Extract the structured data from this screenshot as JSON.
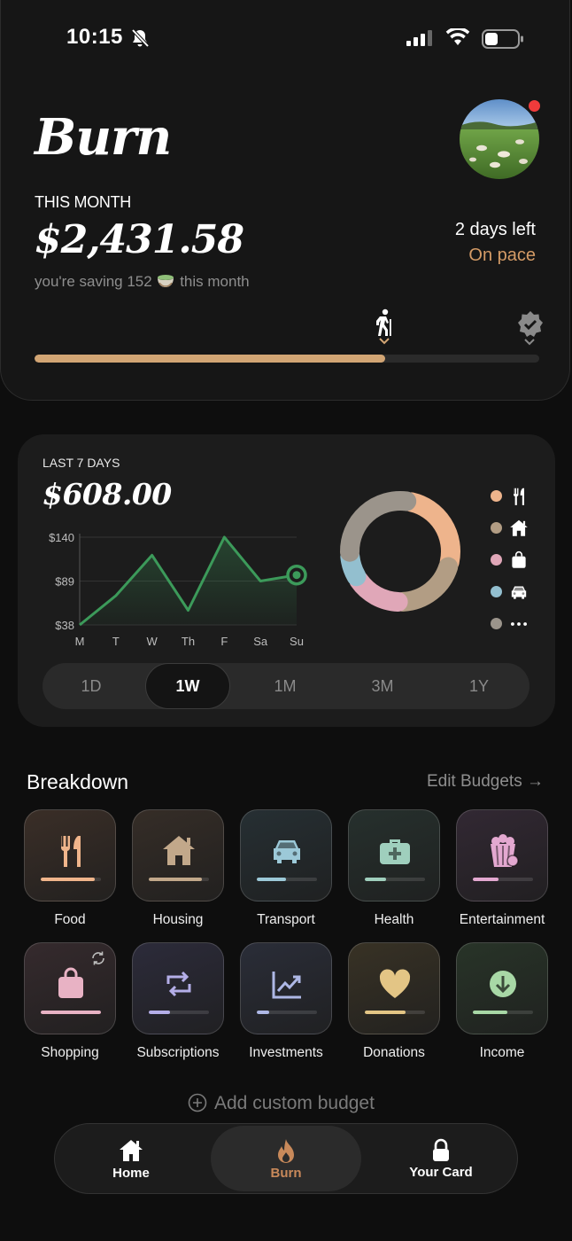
{
  "status_bar": {
    "time": "10:15"
  },
  "header": {
    "title": "Burn",
    "period_label": "THIS MONTH",
    "amount": "$2,431.58",
    "saving_text": "you're saving 152",
    "saving_suffix": "this month",
    "days_left": "2 days left",
    "pace_status": "On pace",
    "progress_fraction": 0.695,
    "accent_color": "#d2a574"
  },
  "weekly": {
    "label": "LAST 7 DAYS",
    "amount": "$608.00",
    "ranges": [
      "1D",
      "1W",
      "1M",
      "3M",
      "1Y"
    ],
    "selected_range": "1W",
    "legend": [
      {
        "icon": "fork-knife-icon",
        "color": "#eeb48c"
      },
      {
        "icon": "house-icon",
        "color": "#b29d84"
      },
      {
        "icon": "bag-icon",
        "color": "#e0a7b8"
      },
      {
        "icon": "car-icon",
        "color": "#93bfcf"
      },
      {
        "icon": "more-icon",
        "color": "#9b948b"
      }
    ]
  },
  "chart_data": [
    {
      "type": "area",
      "categories": [
        "M",
        "T",
        "W",
        "Th",
        "F",
        "Sa",
        "Su"
      ],
      "values": [
        38,
        72,
        119,
        55,
        140,
        89,
        96
      ],
      "y_tick_labels": [
        "$140",
        "$89",
        "$38"
      ],
      "ylim": [
        38,
        140
      ],
      "line_color": "#3c9a5a",
      "grid": true
    },
    {
      "type": "pie",
      "style": "donut",
      "slices": [
        {
          "category": "food",
          "value": 23,
          "color": "#eeb48c"
        },
        {
          "category": "housing",
          "value": 18,
          "color": "#b29d84"
        },
        {
          "category": "shopping",
          "value": 14,
          "color": "#e0a7b8"
        },
        {
          "category": "transport",
          "value": 7,
          "color": "#93bfcf"
        },
        {
          "category": "other",
          "value": 25,
          "color": "#9b948b"
        }
      ]
    }
  ],
  "breakdown": {
    "title": "Breakdown",
    "edit_label": "Edit Budgets →",
    "add_label": "Add custom budget",
    "categories": [
      {
        "label": "Food",
        "icon": "fork-knife-icon",
        "color": "#f0b58b",
        "bg": "#3a2e27",
        "fill": 0.9
      },
      {
        "label": "Housing",
        "icon": "house-icon",
        "color": "#c2a88a",
        "bg": "#352d27",
        "fill": 0.88
      },
      {
        "label": "Transport",
        "icon": "car-icon",
        "color": "#9cc9d8",
        "bg": "#262f33",
        "fill": 0.48
      },
      {
        "label": "Health",
        "icon": "medkit-icon",
        "color": "#9fcfbd",
        "bg": "#26302d",
        "fill": 0.36
      },
      {
        "label": "Entertainment",
        "icon": "popcorn-icon",
        "color": "#e3a8d0",
        "bg": "#322833",
        "fill": 0.42
      },
      {
        "label": "Shopping",
        "icon": "bag-icon",
        "color": "#e8b2c4",
        "bg": "#352a2d",
        "fill": 1.0
      },
      {
        "label": "Subscriptions",
        "icon": "repeat-icon",
        "color": "#b4aee8",
        "bg": "#2c2b3a",
        "fill": 0.36
      },
      {
        "label": "Investments",
        "icon": "trend-up-icon",
        "color": "#aeb8e6",
        "bg": "#2a2d38",
        "fill": 0.2
      },
      {
        "label": "Donations",
        "icon": "heart-icon",
        "color": "#e3c585",
        "bg": "#383225",
        "fill": 0.68
      },
      {
        "label": "Income",
        "icon": "download-icon",
        "color": "#a8d8a6",
        "bg": "#283428",
        "fill": 0.58
      }
    ]
  },
  "nav": {
    "items": [
      {
        "label": "Home",
        "icon": "home-icon"
      },
      {
        "label": "Burn",
        "icon": "flame-icon",
        "active": true,
        "color": "#c8895a"
      },
      {
        "label": "Your Card",
        "icon": "lock-icon"
      }
    ]
  }
}
